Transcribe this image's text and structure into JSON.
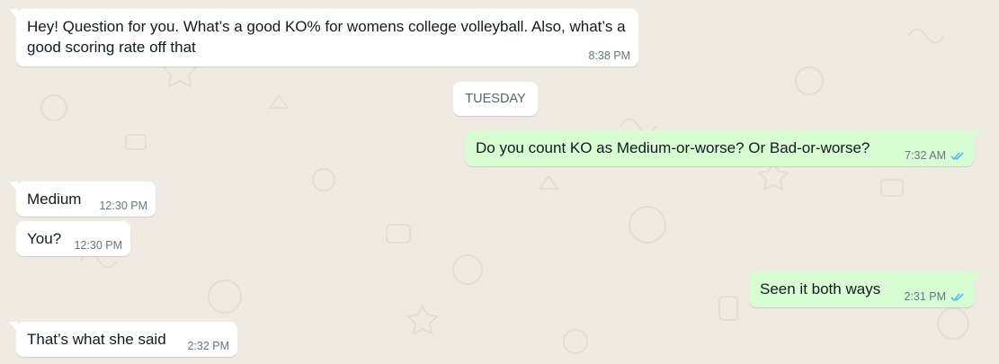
{
  "chat": {
    "day_separator": "TUESDAY",
    "messages": [
      {
        "direction": "in",
        "text": "Hey! Question for you. What’s a good KO% for womens college volleyball. Also, what’s a good scoring rate off that",
        "time": "8:38 PM"
      },
      {
        "direction": "out",
        "text": "Do you count KO as Medium-or-worse? Or Bad-or-worse?",
        "time": "7:32 AM",
        "status": "read"
      },
      {
        "direction": "in",
        "text": "Medium",
        "time": "12:30 PM"
      },
      {
        "direction": "in",
        "text": "You?",
        "time": "12:30 PM"
      },
      {
        "direction": "out",
        "text": "Seen it both ways",
        "time": "2:31 PM",
        "status": "read"
      },
      {
        "direction": "in",
        "text": "That’s what she said",
        "time": "2:32 PM"
      }
    ]
  },
  "colors": {
    "wallpaper": "#efeae2",
    "incoming_bubble": "#ffffff",
    "outgoing_bubble": "#d9fdd3",
    "read_ticks": "#53bdeb",
    "timestamp": "#667781"
  },
  "icons": {
    "read_receipt": "double-check-icon",
    "wallpaper_doodles": "doodle-pattern"
  }
}
